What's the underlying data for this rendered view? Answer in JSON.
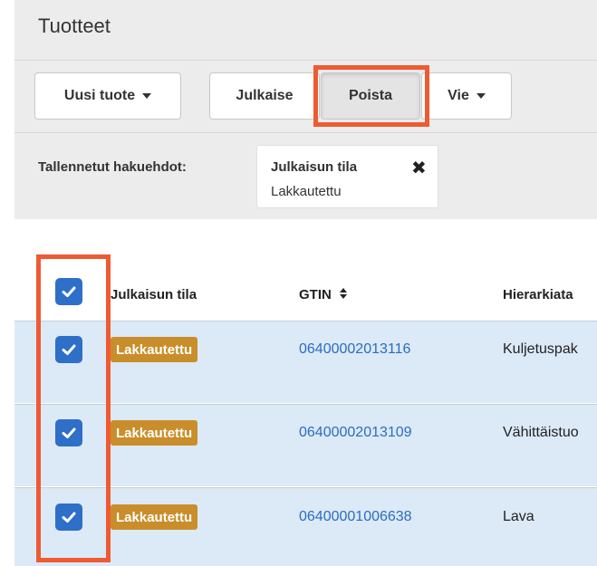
{
  "page": {
    "title": "Tuotteet"
  },
  "toolbar": {
    "new_product": "Uusi tuote",
    "publish": "Julkaise",
    "delete": "Poista",
    "export": "Vie"
  },
  "saved_filters": {
    "label": "Tallennetut hakuehdot:",
    "chip": {
      "name": "Julkaisun tila",
      "value": "Lakkautettu"
    }
  },
  "table": {
    "columns": [
      "Julkaisun tila",
      "GTIN",
      "Hierarkiata"
    ],
    "rows": [
      {
        "status": "Lakkautettu",
        "gtin": "06400002013116",
        "hierarchy": "Kuljetuspak"
      },
      {
        "status": "Lakkautettu",
        "gtin": "06400002013109",
        "hierarchy": "Vähittäistuo"
      },
      {
        "status": "Lakkautettu",
        "gtin": "06400001006638",
        "hierarchy": "Lava"
      }
    ]
  },
  "colors": {
    "highlight": "#ee5b32",
    "checkbox": "#2e6fc7",
    "badge": "#c98e2b",
    "link": "#2a6ebf",
    "row_selected": "#dce9f7"
  }
}
